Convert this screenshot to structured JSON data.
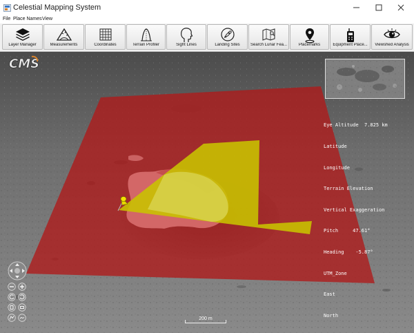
{
  "window": {
    "title": "Celestial Mapping System"
  },
  "menu": {
    "items": [
      "File",
      "Place Names",
      "View"
    ]
  },
  "toolbar": {
    "buttons": [
      {
        "label": "Layer Manager",
        "icon": "layers-icon"
      },
      {
        "label": "Measurements",
        "icon": "protractor-icon"
      },
      {
        "label": "Coordinates",
        "icon": "grid-icon"
      },
      {
        "label": "Terrain Profiler",
        "icon": "terrain-profile-icon"
      },
      {
        "label": "Sight Lines",
        "icon": "head-profile-icon"
      },
      {
        "label": "Landing Sites",
        "icon": "rocket-icon"
      },
      {
        "label": "Search Lunar Fea...",
        "icon": "map-search-icon"
      },
      {
        "label": "Placemarks",
        "icon": "map-pin-icon"
      },
      {
        "label": "Equipment Place...",
        "icon": "radio-icon"
      },
      {
        "label": "Viewshed Analysis",
        "icon": "eye-icon"
      }
    ]
  },
  "logo": {
    "text": "CMS"
  },
  "readout": {
    "eye_altitude": "Eye Altitude  7.825 km",
    "latitude": "Latitude",
    "longitude": "Longitude",
    "terrain_elevation": "Terrain Elevation",
    "vertical_exaggeration": "Vertical Exaggeration",
    "pitch": "Pitch     47.61°",
    "heading": "Heading    -5.87°",
    "utm_zone": "UTM_Zone",
    "east": "East",
    "north": "North"
  },
  "scalebar": {
    "label": "200 m"
  },
  "colors": {
    "viewshed_visible": "#c8c400",
    "viewshed_hidden": "#b01a1a",
    "toolbar_bg": "#f0f0f0"
  }
}
